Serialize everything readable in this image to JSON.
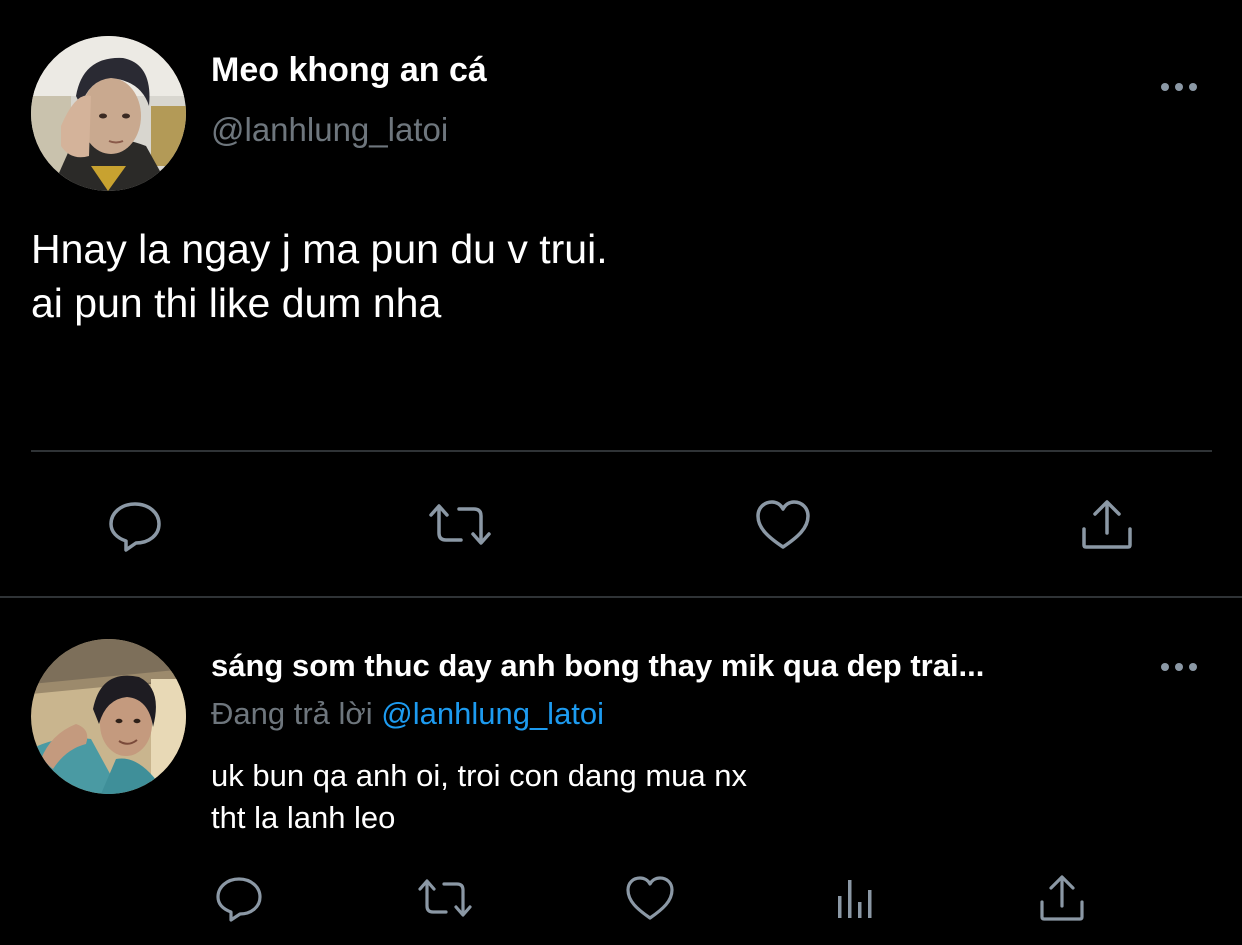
{
  "main_tweet": {
    "display_name": "Meo khong an cá",
    "handle": "@lanhlung_latoi",
    "text_lines": [
      "Hnay la ngay j ma pun du v trui.",
      "ai pun thi like dum nha"
    ],
    "actions": [
      "reply-icon",
      "retweet-icon",
      "like-icon",
      "share-icon"
    ]
  },
  "reply_tweet": {
    "display_name": "sáng som thuc day anh bong thay mik qua dep trai...",
    "replying_to_prefix": "Đang trả lời",
    "replying_to_handle": "@lanhlung_latoi",
    "text_lines": [
      "uk bun qa anh oi, troi con dang mua nx",
      "tht la lanh leo"
    ],
    "actions": [
      "reply-icon",
      "retweet-icon",
      "like-icon",
      "analytics-icon",
      "share-icon"
    ]
  },
  "colors": {
    "background": "#000000",
    "primary_text": "#ffffff",
    "secondary_text": "#6e767d",
    "icon": "#8b98a5",
    "mention": "#1d9bf0",
    "divider": "#2f3336"
  }
}
